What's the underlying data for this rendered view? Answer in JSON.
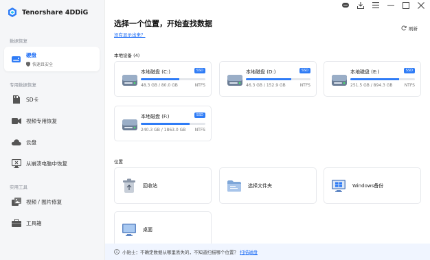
{
  "app": {
    "name": "Tenorshare 4DDiG"
  },
  "sidebar": {
    "section1": "数据恢复",
    "active_item": {
      "label": "硬盘",
      "sub": "快速且安全",
      "icon": "hard-drive-icon"
    },
    "section2": "专用数据恢复",
    "items": [
      {
        "label": "SD卡",
        "icon": "sd-card-icon"
      },
      {
        "label": "视频专用恢复",
        "icon": "video-icon"
      },
      {
        "label": "云盘",
        "icon": "cloud-icon"
      },
      {
        "label": "从崩溃电脑中恢复",
        "icon": "crashed-pc-icon"
      }
    ],
    "section3": "实用工具",
    "tools": [
      {
        "label": "视频 / 图片修复",
        "icon": "photo-repair-icon"
      },
      {
        "label": "工具箱",
        "icon": "toolbox-icon"
      }
    ]
  },
  "main": {
    "heading": "选择一个位置，开始查找数据",
    "help_link": "没有显示出来？",
    "refresh": "刷新",
    "devices_label": "本地设备 (4)",
    "drives": [
      {
        "name": "本地磁盘 (C:)",
        "badge": "SSD",
        "size": "48.3 GB / 80.0 GB",
        "fs": "NTFS",
        "used_fraction": 0.6
      },
      {
        "name": "本地磁盘 (D:)",
        "badge": "SSD",
        "size": "46.3 GB / 152.9 GB",
        "fs": "NTFS",
        "used_fraction": 0.7
      },
      {
        "name": "本地磁盘 (E:)",
        "badge": "SSD",
        "size": "251.5 GB / 894.3 GB",
        "fs": "NTFS",
        "used_fraction": 0.75
      },
      {
        "name": "本地磁盘 (F:)",
        "badge": "SSD",
        "size": "240.3 GB / 1863.0 GB",
        "fs": "NTFS",
        "used_fraction": 0.75
      }
    ],
    "locations_label": "位置",
    "locations": [
      {
        "label": "回收站",
        "icon": "recycle-bin-icon"
      },
      {
        "label": "选择文件夹",
        "icon": "folder-icon"
      },
      {
        "label": "Windows备份",
        "icon": "windows-backup-icon"
      },
      {
        "label": "桌面",
        "icon": "desktop-icon"
      }
    ]
  },
  "tip": {
    "text": "小贴士：不确定数据从哪里丢失的，不知道扫描哪个位置？",
    "link": "扫描磁盘"
  },
  "colors": {
    "accent": "#2f7cf6",
    "link": "#1d6df5"
  }
}
